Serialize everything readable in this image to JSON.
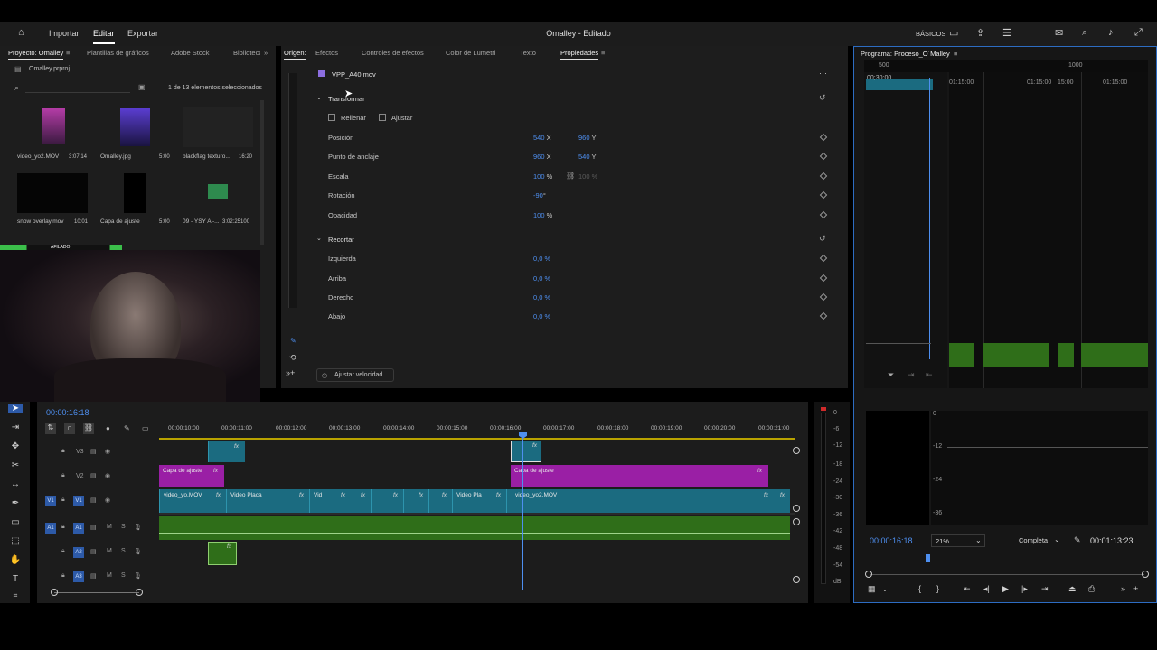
{
  "app": {
    "title": "Omalley - Editado",
    "menu": [
      "Importar",
      "Editar",
      "Exportar"
    ],
    "workspace": "BÁSICOS"
  },
  "project": {
    "tabs": [
      "Proyecto: Omalley",
      "Plantillas de gráficos",
      "Adobe Stock",
      "Biblioteca"
    ],
    "file": "Omalley.prproj",
    "search_placeholder": "",
    "selection_info": "1 de 13 elementos seleccionados",
    "items": [
      {
        "name": "video_yo2.MOV",
        "duration": "3:07:14"
      },
      {
        "name": "Omalley.jpg",
        "duration": "5:00"
      },
      {
        "name": "blackflag texturo...",
        "duration": "16:20"
      },
      {
        "name": "snow overlay.mov",
        "duration": "10:01"
      },
      {
        "name": "Capa de ajuste",
        "duration": "5:00"
      },
      {
        "name": "09 - YSY A -...",
        "duration": "3:02:25100"
      }
    ],
    "strip_label": "AFILADO"
  },
  "source": {
    "tab": "Origen:"
  },
  "effects": {
    "tabs": [
      "Efectos",
      "Controles de efectos",
      "Color de Lumetri",
      "Texto",
      "Propiedades"
    ],
    "clip_name": "VPP_A40.mov",
    "transform": {
      "title": "Transformar",
      "fill_label": "Rellenar",
      "fit_label": "Ajustar",
      "props": [
        {
          "name": "Posición",
          "v1": "540",
          "u1": "X",
          "v2": "960",
          "u2": "Y"
        },
        {
          "name": "Punto de anclaje",
          "v1": "960",
          "u1": "X",
          "v2": "540",
          "u2": "Y"
        },
        {
          "name": "Escala",
          "v1": "100",
          "u1": "%",
          "v2": "100",
          "u2": "%"
        },
        {
          "name": "Rotación",
          "v1": "-90",
          "u1": "°"
        },
        {
          "name": "Opacidad",
          "v1": "100",
          "u1": "%"
        }
      ]
    },
    "crop": {
      "title": "Recortar",
      "props": [
        {
          "name": "Izquierda",
          "value": "0,0 %"
        },
        {
          "name": "Arriba",
          "value": "0,0 %"
        },
        {
          "name": "Derecho",
          "value": "0,0 %"
        },
        {
          "name": "Abajo",
          "value": "0,0 %"
        }
      ]
    },
    "speed_button": "Ajustar velocidad..."
  },
  "program": {
    "title": "Programa: Proceso_O´Malley",
    "timecode": "00:00:16:18",
    "zoom": "21%",
    "quality": "Completa",
    "duration": "00:01:13:23",
    "ruler": [
      "500",
      "1000",
      "00;30:00",
      "01:15:00",
      "01:15:00",
      "15:00",
      "01:15:00"
    ]
  },
  "timeline": {
    "timecode": "00:00:16:18",
    "ticks": [
      "00:00:10:00",
      "00:00:11:00",
      "00:00:12:00",
      "00:00:13:00",
      "00:00:14:00",
      "00:00:15:00",
      "00:00:16:00",
      "00:00:17:00",
      "00:00:18:00",
      "00:00:19:00",
      "00:00:20:00",
      "00:00:21:00"
    ],
    "tracks": [
      "V3",
      "V2",
      "V1",
      "A1",
      "A2",
      "A3"
    ],
    "source_patch": [
      "V1",
      "A1"
    ],
    "clips": {
      "v2_left": "Capa de ajuste",
      "v2_right": "Capa de ajuste",
      "v1_a": "video_yo.MOV",
      "v1_b": "Video Placa",
      "v1_c": "Vid",
      "v1_d": "Video Pla",
      "v1_e": "video_yo2.MOV",
      "fx": "fx"
    },
    "meter_labels": [
      "0",
      "-6",
      "-12",
      "-18",
      "-24",
      "-30",
      "-36",
      "-42",
      "-48",
      "-54",
      "dB"
    ]
  },
  "audio_meter": {
    "labels": [
      "0",
      "-12",
      "-24",
      "-36"
    ]
  },
  "colors": {
    "accent": "#2d8ceb",
    "video_clip": "#1b6b80",
    "adjustment_clip": "#9a1fa5",
    "audio_clip": "#2f6e19"
  }
}
